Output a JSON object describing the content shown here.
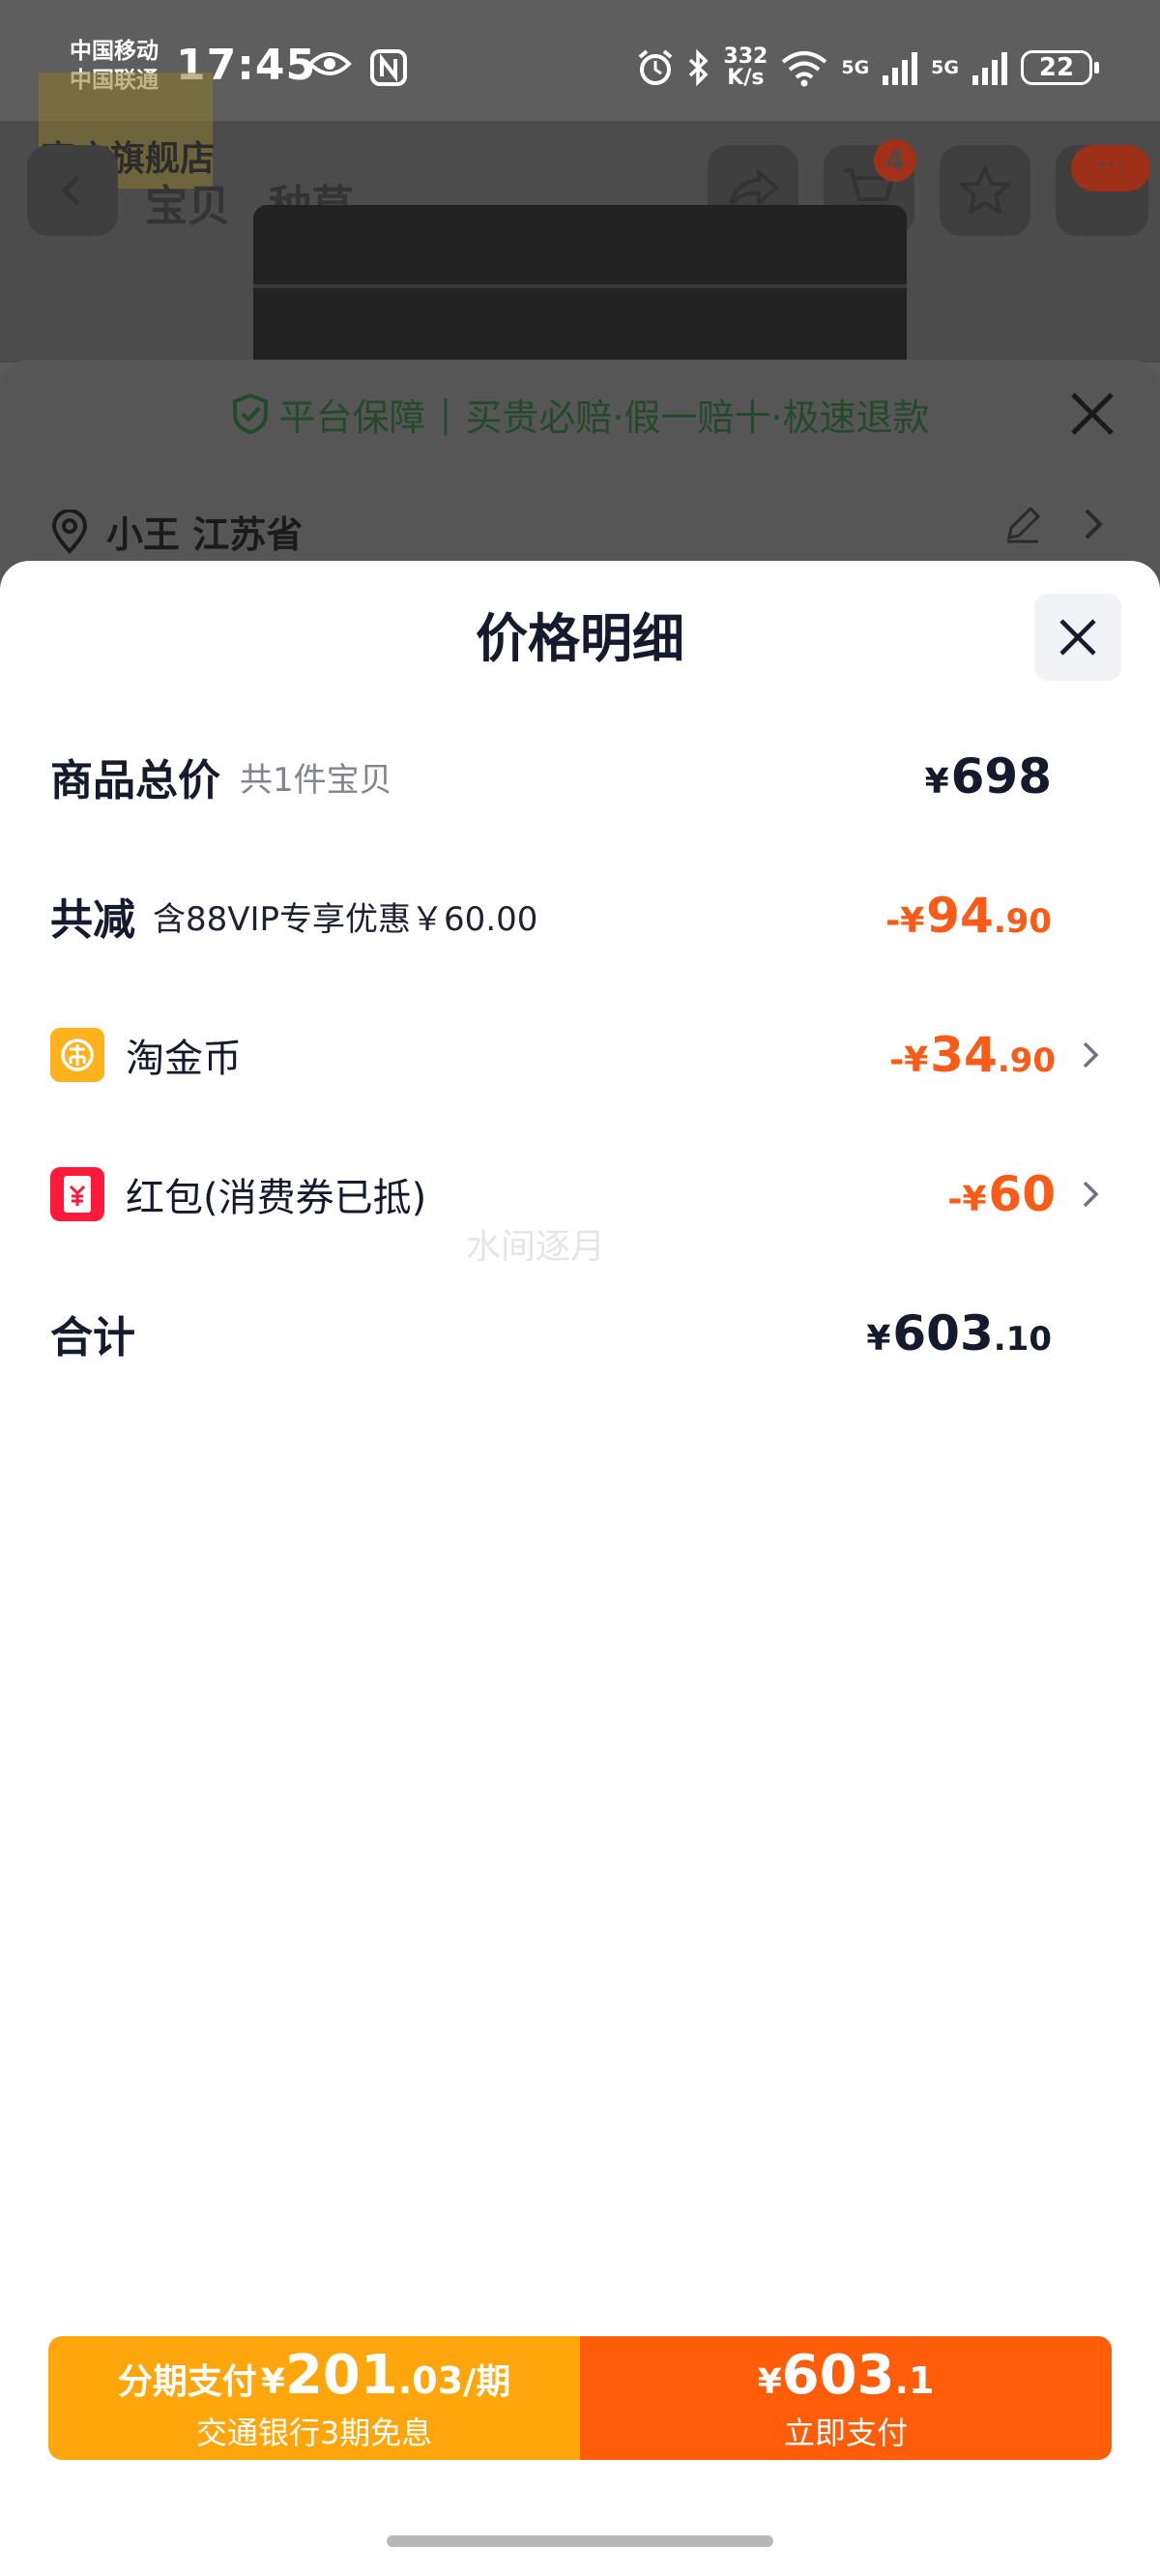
{
  "status_bar": {
    "carrier1": "中国移动",
    "carrier2": "中国联通",
    "time": "17:45",
    "speed_value": "332",
    "speed_unit": "K/s",
    "net1": "5G",
    "net2": "5G",
    "battery": "22"
  },
  "background": {
    "store_name": "官方旗舰店",
    "tabs": [
      "宝贝",
      "种草"
    ],
    "cart_count": "4",
    "more_badge": "···",
    "guarantee": {
      "title": "平台保障",
      "text": "买贵必赔·假一赔十·极速退款"
    },
    "address_name": "小王 江苏省"
  },
  "sheet": {
    "title": "价格明细",
    "rows": {
      "total": {
        "label": "商品总价",
        "sub": "共1件宝贝",
        "yen": "¥",
        "int": "698",
        "dec": ""
      },
      "reduce": {
        "label": "共减",
        "sub": "含88VIP专享优惠￥60.00",
        "yen": "-¥",
        "int": "94",
        "dec": ".90"
      },
      "coins": {
        "label": "淘金币",
        "yen": "-¥",
        "int": "34",
        "dec": ".90"
      },
      "redpacket": {
        "label": "红包(消费券已抵)",
        "yen": "-¥",
        "int": "60",
        "dec": ""
      },
      "sum": {
        "label": "合计",
        "yen": "¥",
        "int": "603",
        "dec": ".10"
      }
    },
    "watermark": "水间逐月"
  },
  "pay": {
    "installment_prefix": "分期支付",
    "installment_yen": "¥",
    "installment_int": "201",
    "installment_dec": ".03",
    "installment_unit": "/期",
    "installment_sub": "交通银行3期免息",
    "now_yen": "¥",
    "now_int": "603",
    "now_dec": ".1",
    "now_label": "立即支付"
  },
  "colors": {
    "accent_orange": "#fa5b17",
    "pay_left": "#ffa60c",
    "pay_right": "#ff5d09",
    "coin_icon": "#ffb21b",
    "redpacket_icon": "#ff1a3c"
  }
}
